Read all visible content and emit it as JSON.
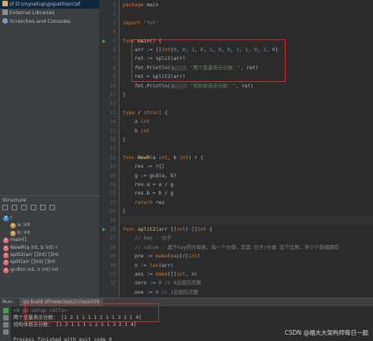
{
  "project": {
    "items": [
      {
        "label": "sf D:\\mysetup\\gopath\\src\\sf",
        "icon": "folder-icon"
      },
      {
        "label": "External Libraries",
        "icon": "library-icon"
      },
      {
        "label": "Scratches and Consoles",
        "icon": "scratches-icon"
      }
    ]
  },
  "structure": {
    "title": "Structure",
    "items": [
      {
        "badge": "T",
        "label": "r",
        "indent": 0
      },
      {
        "badge": "v",
        "label": "a: int",
        "indent": 1
      },
      {
        "badge": "v",
        "label": "b: int",
        "indent": 1
      },
      {
        "badge": "f",
        "label": "main()",
        "indent": 0
      },
      {
        "badge": "f",
        "label": "NewR(a int, b int) r",
        "indent": 0
      },
      {
        "badge": "f",
        "label": "split2(arr []int) []int",
        "indent": 0
      },
      {
        "badge": "f",
        "label": "split(arr []int) []int",
        "indent": 0
      },
      {
        "badge": "f",
        "label": "gcd(m int, n int) int",
        "indent": 0
      }
    ]
  },
  "editor": {
    "line_numbers": [
      "1",
      "2",
      "3",
      "4",
      "5",
      "6",
      "7",
      "8",
      "9",
      "10",
      "11",
      "12",
      "13",
      "14",
      "15",
      "16",
      "17",
      "18",
      "19",
      "20",
      "21",
      "22",
      "23",
      "24",
      "25",
      "26",
      "27",
      "28",
      "29",
      "30",
      "31",
      "32"
    ],
    "lines": [
      [
        {
          "t": "package ",
          "c": "k"
        },
        {
          "t": "main",
          "c": ""
        }
      ],
      [],
      [
        {
          "t": "import ",
          "c": "k"
        },
        {
          "t": "\"fmt\"",
          "c": "s"
        }
      ],
      [],
      [
        {
          "t": "func ",
          "c": "k"
        },
        {
          "t": "main",
          "c": "fnm"
        },
        {
          "t": "() {",
          "c": ""
        }
      ],
      [
        {
          "t": "    arr := []",
          "c": ""
        },
        {
          "t": "int",
          "c": "tp"
        },
        {
          "t": "{",
          "c": ""
        },
        {
          "t": "0",
          "c": "n"
        },
        {
          "t": ", ",
          "c": ""
        },
        {
          "t": "0",
          "c": "n"
        },
        {
          "t": ", ",
          "c": ""
        },
        {
          "t": "1",
          "c": "n"
        },
        {
          "t": ", ",
          "c": ""
        },
        {
          "t": "0",
          "c": "n"
        },
        {
          "t": ", ",
          "c": ""
        },
        {
          "t": "1",
          "c": "n"
        },
        {
          "t": ", ",
          "c": ""
        },
        {
          "t": "0",
          "c": "n"
        },
        {
          "t": ", ",
          "c": ""
        },
        {
          "t": "0",
          "c": "n"
        },
        {
          "t": ", ",
          "c": ""
        },
        {
          "t": "1",
          "c": "n"
        },
        {
          "t": ", ",
          "c": ""
        },
        {
          "t": "1",
          "c": "n"
        },
        {
          "t": ", ",
          "c": ""
        },
        {
          "t": "0",
          "c": "n"
        },
        {
          "t": ", ",
          "c": ""
        },
        {
          "t": "1",
          "c": "n"
        },
        {
          "t": ", ",
          "c": ""
        },
        {
          "t": "0",
          "c": "n"
        },
        {
          "t": "}",
          "c": ""
        }
      ],
      [
        {
          "t": "    ret := split(arr)",
          "c": ""
        }
      ],
      [
        {
          "t": "    fmt.Println(",
          "c": ""
        },
        {
          "t": "a...:",
          "c": "hint"
        },
        {
          "t": " \"两个变量表示分数：\"",
          "c": "s"
        },
        {
          "t": ", ret)",
          "c": ""
        }
      ],
      [
        {
          "t": "    ret = split2(arr)",
          "c": ""
        }
      ],
      [
        {
          "t": "    fmt.Println(",
          "c": ""
        },
        {
          "t": "a...:",
          "c": "hint"
        },
        {
          "t": " \"结构体表示分数：\"",
          "c": "s"
        },
        {
          "t": ", ret)",
          "c": ""
        }
      ],
      [
        {
          "t": "}",
          "c": ""
        }
      ],
      [],
      [
        {
          "t": "type ",
          "c": "k"
        },
        {
          "t": "r ",
          "c": ""
        },
        {
          "t": "struct ",
          "c": "k"
        },
        {
          "t": "{",
          "c": ""
        }
      ],
      [
        {
          "t": "    a ",
          "c": ""
        },
        {
          "t": "int",
          "c": "tp"
        }
      ],
      [
        {
          "t": "    b ",
          "c": ""
        },
        {
          "t": "int",
          "c": "tp"
        }
      ],
      [
        {
          "t": "}",
          "c": ""
        }
      ],
      [],
      [
        {
          "t": "func ",
          "c": "k"
        },
        {
          "t": "NewR",
          "c": "fnm"
        },
        {
          "t": "(a ",
          "c": ""
        },
        {
          "t": "int",
          "c": "tp"
        },
        {
          "t": ", b ",
          "c": ""
        },
        {
          "t": "int",
          "c": "tp"
        },
        {
          "t": ") r {",
          "c": ""
        }
      ],
      [
        {
          "t": "    res := r{}",
          "c": ""
        }
      ],
      [
        {
          "t": "    g := gcd(a, b)",
          "c": ""
        }
      ],
      [
        {
          "t": "    res.a = a / g",
          "c": ""
        }
      ],
      [
        {
          "t": "    res.b = b / g",
          "c": ""
        }
      ],
      [
        {
          "t": "    ",
          "c": ""
        },
        {
          "t": "return ",
          "c": "k"
        },
        {
          "t": "res",
          "c": ""
        }
      ],
      [
        {
          "t": "}",
          "c": ""
        }
      ],
      [],
      [
        {
          "t": "func ",
          "c": "k"
        },
        {
          "t": "split2",
          "c": "fnm"
        },
        {
          "t": "(arr []",
          "c": ""
        },
        {
          "t": "int",
          "c": "tp"
        },
        {
          "t": ") []",
          "c": ""
        },
        {
          "t": "int",
          "c": "tp"
        },
        {
          "t": " {",
          "c": ""
        }
      ],
      [
        {
          "t": "    // key : 分子",
          "c": "cm"
        }
      ],
      [
        {
          "t": "    // value : 属于key的分母表，每一个分母，及其 分子/分母 这个比例，多少个前缀拥有",
          "c": "cm"
        }
      ],
      [
        {
          "t": "    pre := ",
          "c": ""
        },
        {
          "t": "make",
          "c": "k"
        },
        {
          "t": "(",
          "c": ""
        },
        {
          "t": "map",
          "c": "k"
        },
        {
          "t": "[r]",
          "c": ""
        },
        {
          "t": "int",
          "c": "tp"
        },
        {
          "t": ")",
          "c": ""
        }
      ],
      [
        {
          "t": "    n := ",
          "c": ""
        },
        {
          "t": "len",
          "c": "k"
        },
        {
          "t": "(arr)",
          "c": ""
        }
      ],
      [
        {
          "t": "    ans := ",
          "c": ""
        },
        {
          "t": "make",
          "c": "k"
        },
        {
          "t": "([]",
          "c": ""
        },
        {
          "t": "int",
          "c": "tp"
        },
        {
          "t": ", n)",
          "c": ""
        }
      ],
      [
        {
          "t": "    zero := ",
          "c": ""
        },
        {
          "t": "0",
          "c": "n"
        },
        {
          "t": " // 0出现的次数",
          "c": "cm"
        }
      ],
      [
        {
          "t": "    one := ",
          "c": ""
        },
        {
          "t": "0",
          "c": "n"
        },
        {
          "t": " // 1出现的次数",
          "c": "cm"
        }
      ],
      [
        {
          "t": "    ",
          "c": ""
        },
        {
          "t": "for ",
          "c": "k"
        },
        {
          "t": "i := ",
          "c": ""
        },
        {
          "t": "0",
          "c": "n"
        },
        {
          "t": "; i < n; i++ {",
          "c": ""
        }
      ]
    ]
  },
  "run": {
    "label": "Run:",
    "tab": "go build sf/newclass2/class036",
    "output": [
      {
        "text": "<4 go setup calls>",
        "color": "#808080"
      },
      {
        "text": "两个变量表示分数： [1 2 1 1 1 1 2 1 1 3 2 1 4]",
        "color": "#bbbbbb"
      },
      {
        "text": "结构体表示分数： [1 2 1 1 1 1 2 1 1 3 2 1 4]",
        "color": "#bbbbbb"
      },
      {
        "text": "",
        "color": "#bbbbbb"
      },
      {
        "text": "Process finished with exit code 0",
        "color": "#bbbbbb"
      }
    ]
  },
  "watermark": "CSDN @福大大架构师每日一题",
  "colors": {
    "highlight_box": "#d9262d",
    "keyword": "#cc7832",
    "string": "#6a8759",
    "number": "#6897bb"
  }
}
